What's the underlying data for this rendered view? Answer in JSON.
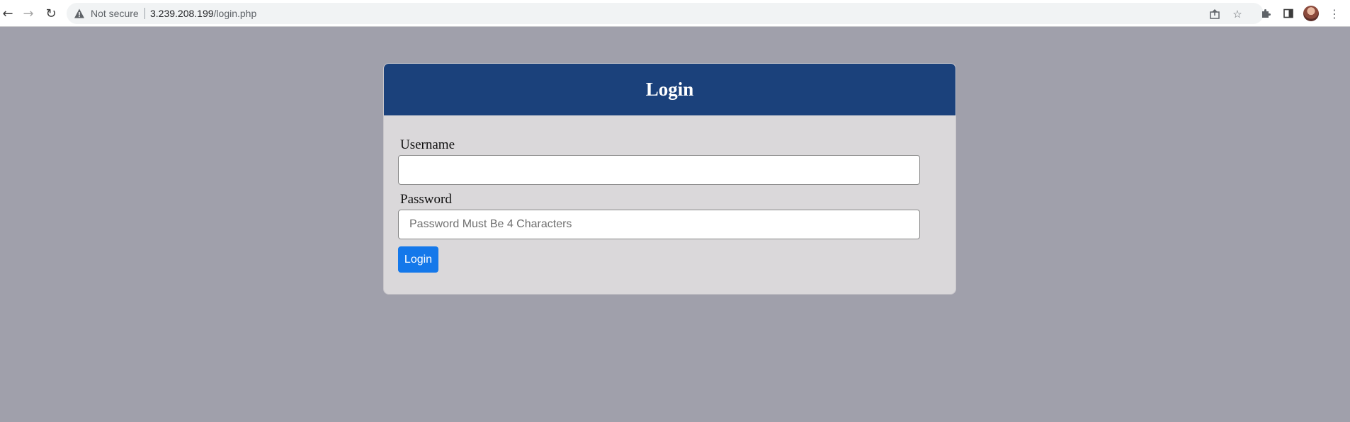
{
  "browser": {
    "security_label": "Not secure",
    "url_host": "3.239.208.199",
    "url_path": "/login.php",
    "icons": [
      "back-arrow-icon",
      "forward-arrow-icon",
      "reload-icon",
      "warning-icon",
      "share-icon",
      "bookmark-star-icon",
      "extensions-puzzle-icon",
      "side-panel-icon",
      "profile-avatar",
      "more-menu-icon"
    ]
  },
  "login": {
    "title": "Login",
    "username_label": "Username",
    "username_value": "",
    "password_label": "Password",
    "password_placeholder": "Password Must Be 4 Characters",
    "submit_label": "Login"
  },
  "colors": {
    "page_background": "#a0a0ab",
    "header_background": "#1b417b",
    "card_background": "#dad8da",
    "button_background": "#1478ea"
  }
}
